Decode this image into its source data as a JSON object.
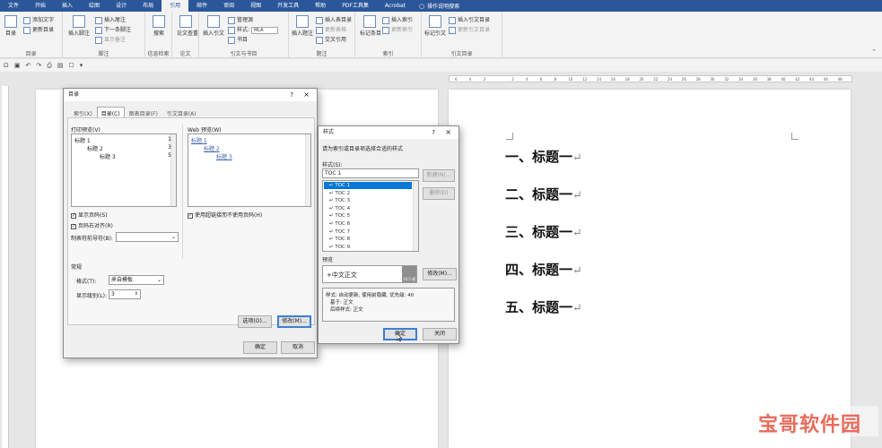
{
  "ribbon_tabs": [
    "文件",
    "开始",
    "插入",
    "绘图",
    "设计",
    "布局",
    "引用",
    "邮件",
    "审阅",
    "视图",
    "开发工具",
    "帮助",
    "PDF工具集",
    "Acrobat"
  ],
  "active_tab": "引用",
  "tell_me": "操作说明搜索",
  "ribbon": {
    "toc_group": {
      "big_label": "目录",
      "add_text": "添加文字",
      "update_toc": "更新目录",
      "group_label": "目录"
    },
    "footnote_group": {
      "insert_footnote": "插入脚注",
      "insert_endnote": "插入尾注",
      "next_footnote": "下一条脚注",
      "show_notes": "显示备注",
      "group_label": "脚注"
    },
    "research_group": {
      "search": "搜索",
      "group_label": "信息检索"
    },
    "paper_group": {
      "paper_check": "论文查重",
      "group_label": "论文"
    },
    "citation_group": {
      "insert_citation": "插入引文",
      "manage_sources": "管理源",
      "style_label": "样式:",
      "style_value": "MLA",
      "bibliography": "书目",
      "group_label": "引文与书目"
    },
    "caption_group": {
      "insert_caption": "插入题注",
      "insert_table_of_figures": "插入表目录",
      "update_table": "更新表格",
      "cross_reference": "交叉引用",
      "group_label": "题注"
    },
    "index_group": {
      "mark_entry": "标记条目",
      "insert_index": "插入索引",
      "update_index": "更新索引",
      "group_label": "索引"
    },
    "authorities_group": {
      "mark_citation": "标记引文",
      "insert_toa": "插入引文目录",
      "update_toa": "更新引文目录",
      "group_label": "引文目录"
    }
  },
  "ruler_ticks": [
    "6",
    "4",
    "2",
    "",
    "2",
    "4",
    "6",
    "8",
    "10",
    "12",
    "14",
    "16",
    "18",
    "20",
    "22",
    "24",
    "26",
    "28",
    "30",
    "32",
    "34",
    "36",
    "38",
    "40",
    "42",
    "44",
    "46",
    "48"
  ],
  "document_headings": [
    "一、标题一",
    "二、标题一",
    "三、标题一",
    "四、标题一",
    "五、标题一"
  ],
  "toc_dialog": {
    "title": "目录",
    "tabs": [
      "索引(X)",
      "目录(C)",
      "图表目录(F)",
      "引文目录(A)"
    ],
    "active_tab": "目录(C)",
    "print_preview_label": "打印预览(V)",
    "print_preview": [
      {
        "text": "标题 1",
        "page": "1"
      },
      {
        "text": "标题 2",
        "page": "3"
      },
      {
        "text": "标题 3",
        "page": "5"
      }
    ],
    "web_preview_label": "Web 预览(W)",
    "web_preview": [
      "标题 1",
      "标题 2",
      "标题 3"
    ],
    "show_page_numbers": "显示页码(S)",
    "right_align": "页码右对齐(R)",
    "tab_leader_label": "制表符前导符(B):",
    "use_hyperlinks": "使用超链接而不使用页码(H)",
    "general_label": "常规",
    "formats_label": "格式(T):",
    "formats_value": "来自模板",
    "show_levels_label": "显示级别(L):",
    "show_levels_value": "3",
    "options_button": "选项(O)...",
    "modify_button": "修改(M)...",
    "ok_button": "确定",
    "cancel_button": "取消"
  },
  "style_dialog": {
    "title": "样式",
    "instruction": "请为索引或目录项选择合适的样式",
    "styles_label": "样式(S):",
    "style_input": "TOC 1",
    "style_list": [
      "TOC 1",
      "TOC 2",
      "TOC 3",
      "TOC 4",
      "TOC 5",
      "TOC 6",
      "TOC 7",
      "TOC 8",
      "TOC 9"
    ],
    "selected_style": "TOC 1",
    "new_button": "新建(N)...",
    "delete_button": "删除(D)",
    "preview_label": "预览",
    "preview_text": "+中文正文",
    "preview_size": "10.5 磅",
    "modify_button": "修改(M)...",
    "description_lines": [
      "样式: 自动更新, 使用前隐藏, 优先级: 40",
      "基于: 正文",
      "后续样式: 正文"
    ],
    "ok_button": "确定",
    "close_button": "关闭"
  },
  "watermark": "宝哥软件园",
  "colors": {
    "ribbon_blue": "#2b579a",
    "select_blue": "#0078d7",
    "watermark_red": "#e86b5b"
  }
}
